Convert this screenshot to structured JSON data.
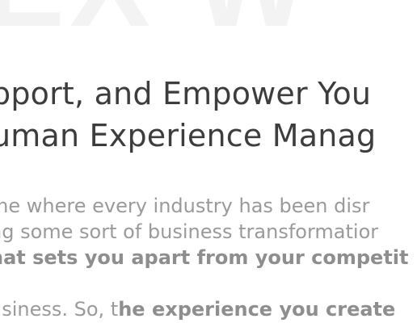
{
  "watermark": {
    "text": "EX W"
  },
  "headline": {
    "line1": "pport, and Empower You",
    "line2": "uman Experience Manag"
  },
  "body": {
    "line1": "me where every industry has been disr",
    "line2": "ng some sort of business transformatior",
    "line3_bold": "hat sets you apart from your competit",
    "line4_plain": "usiness. So, t",
    "line4_bold": "he experience you create"
  }
}
